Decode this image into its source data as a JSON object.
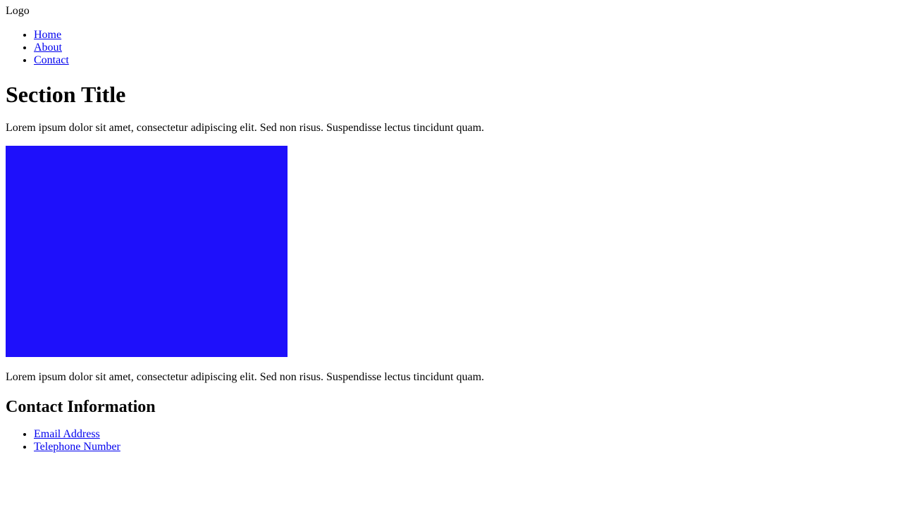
{
  "header": {
    "logo": "Logo",
    "nav": [
      {
        "label": "Home"
      },
      {
        "label": "About"
      },
      {
        "label": "Contact"
      }
    ]
  },
  "main": {
    "section_title": "Section Title",
    "paragraph_1": "Lorem ipsum dolor sit amet, consectetur adipiscing elit. Sed non risus. Suspendisse lectus tincidunt quam.",
    "image_color": "#1e10fb",
    "paragraph_2": "Lorem ipsum dolor sit amet, consectetur adipiscing elit. Sed non risus. Suspendisse lectus tincidunt quam."
  },
  "footer": {
    "contact_title": "Contact Information",
    "links": [
      {
        "label": "Email Address"
      },
      {
        "label": "Telephone Number"
      }
    ]
  },
  "colors": {
    "link": "#0000ee",
    "text": "#000000",
    "background": "#ffffff"
  }
}
